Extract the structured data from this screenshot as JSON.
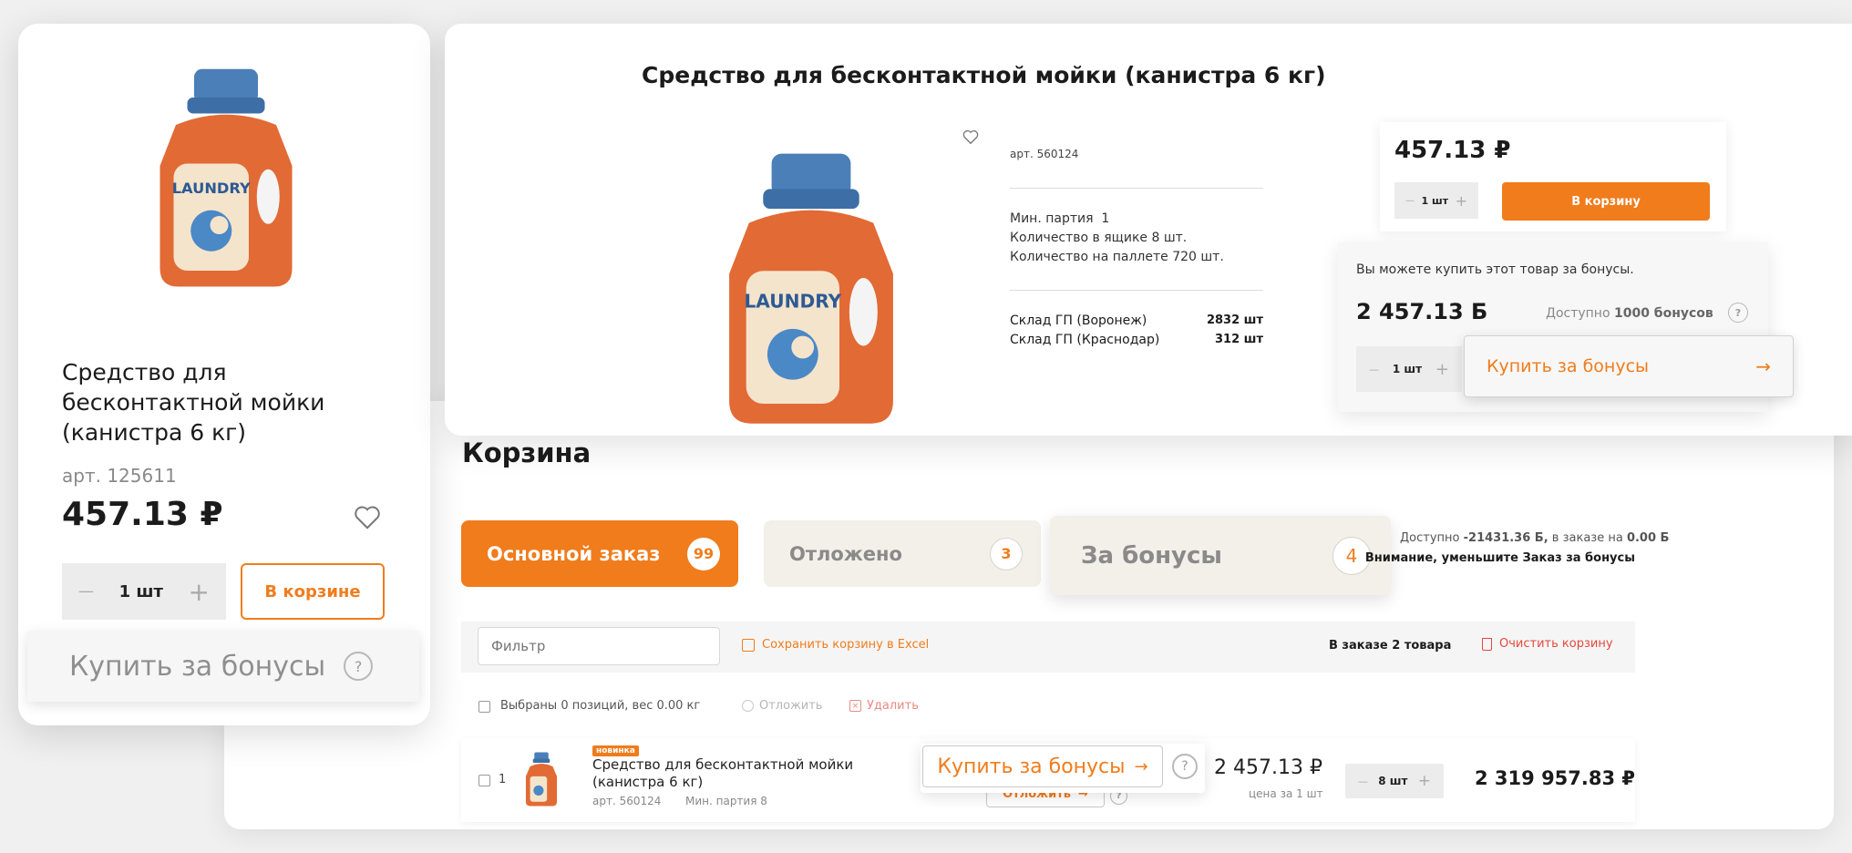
{
  "left_card": {
    "product_title": "Средство для бесконтактной мойки (канистра 6 кг)",
    "article": "арт. 125611",
    "price": "457.13 ₽",
    "qty": "1 шт",
    "minus": "—",
    "plus": "+",
    "in_cart_label": "В корзине",
    "buy_bonus_label": "Купить за бонусы",
    "help": "?"
  },
  "product_popup": {
    "title": "Средство для бесконтактной мойки (канистра 6 кг)",
    "article": "арт. 560124",
    "min_batch": "Мин. партия  1",
    "qty_box": "Количество в ящике 8 шт.",
    "qty_pallet": "Количество на паллете 720 шт.",
    "stock": [
      {
        "name": "Склад ГП (Воронеж)",
        "value": "2832 шт"
      },
      {
        "name": "Склад ГП (Краснодар)",
        "value": "312 шт"
      }
    ],
    "price": "457.13 ₽",
    "qty": "1 шт",
    "minus": "—",
    "plus": "+",
    "add_to_cart": "В корзину",
    "bonus_box": {
      "note": "Вы можете купить этот товар за бонусы.",
      "bonus_price": "2 457.13 Б",
      "available_prefix": "Доступно",
      "available_value": "1000 бонусов",
      "help": "?",
      "qty": "1 шт",
      "minus": "—",
      "plus": "+",
      "buy_label": "Купить за бонусы",
      "arrow": "→"
    }
  },
  "cart": {
    "title": "Корзина",
    "tabs": [
      {
        "label": "Основной заказ",
        "count": "99"
      },
      {
        "label": "Отложено",
        "count": "3"
      },
      {
        "label": "За бонусы",
        "count": "4"
      }
    ],
    "info_prefix": "Доступно",
    "info_available": "-21431.36 Б,",
    "info_mid": "в заказе на",
    "info_order": "0.00 Б",
    "warning": "Внимание, уменьшите Заказ за бонусы",
    "filter_placeholder": "Фильтр",
    "save_excel": "Сохранить корзину в Excel",
    "in_order": "В заказе 2 товара",
    "clear_cart": "Очистить корзину",
    "selected_info": "Выбраны 0 позиций, вес 0.00 кг",
    "postpone": "Отложить",
    "delete": "Удалить",
    "row": {
      "index": "1",
      "badge": "новинка",
      "name": "Средство для бесконтактной мойки (канистра 6 кг)",
      "article": "арт. 560124",
      "min_batch": "Мин. партия  8",
      "buy_bonus": "Купить за бонусы",
      "arrow": "→",
      "help": "?",
      "postpone": "Отложить",
      "price": "2 457.13 ₽",
      "price_note": "цена за 1 шт",
      "qty": "8 шт",
      "minus": "—",
      "plus": "+",
      "total": "2 319 957.83 ₽"
    }
  },
  "colors": {
    "accent": "#f07c1c",
    "danger": "#e5483c",
    "tab_inactive": "#f3efe9"
  },
  "icons": [
    "heart-icon",
    "question-icon",
    "arrow-right-icon",
    "excel-icon",
    "trash-icon",
    "clock-icon",
    "close-icon",
    "bottle-image"
  ]
}
